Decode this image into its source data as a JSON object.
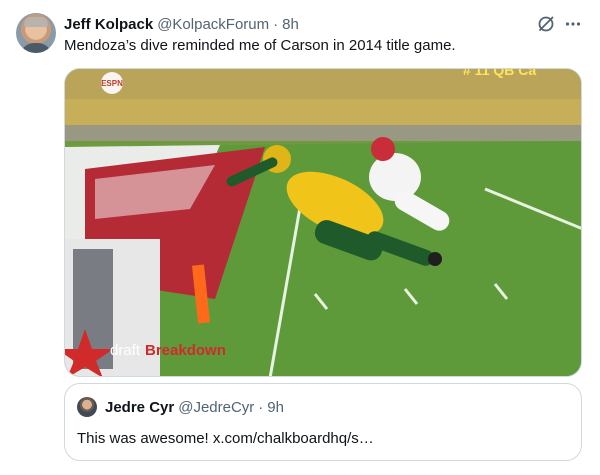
{
  "tweet": {
    "author": {
      "display_name": "Jeff Kolpack",
      "handle": "@KolpackForum",
      "separator": "·",
      "time": "8h"
    },
    "text": "Mendoza’s dive reminded me of Carson in 2014 title game.",
    "actions": {
      "grok_icon": "grok-slash-circle-icon",
      "more_icon": "more-horizontal-icon"
    },
    "media": {
      "broadcaster_logo": "ESPN",
      "top_banner": "# 11 QB Ca",
      "watermark_prefix": "draft",
      "watermark_suffix": "Breakdown"
    },
    "quote": {
      "author": {
        "display_name": "Jedre Cyr",
        "handle": "@JedreCyr",
        "separator": "·",
        "time": "9h"
      },
      "text": "This was awesome! x.com/chalkboardhq/s…"
    }
  },
  "colors": {
    "text_primary": "#0f1419",
    "text_secondary": "#536471",
    "border": "#cfd9de",
    "endzone_red": "#b42b35",
    "field_green": "#5f9a3a",
    "jersey_yellow": "#f0c419",
    "jersey_green": "#1e5a2a"
  }
}
